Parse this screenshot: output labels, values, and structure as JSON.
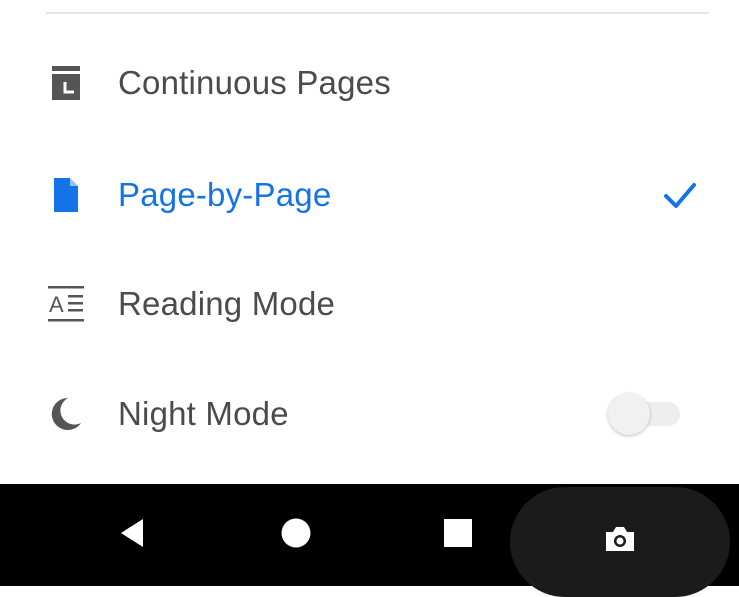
{
  "menu": {
    "items": [
      {
        "id": "continuous",
        "label": "Continuous Pages",
        "icon": "continuous-pages-icon",
        "selected": false
      },
      {
        "id": "page-by-page",
        "label": "Page-by-Page",
        "icon": "page-icon",
        "selected": true
      },
      {
        "id": "reading-mode",
        "label": "Reading Mode",
        "icon": "reading-mode-icon",
        "selected": false
      },
      {
        "id": "night-mode",
        "label": "Night Mode",
        "icon": "moon-icon",
        "selected": false,
        "toggle_on": false
      }
    ]
  },
  "colors": {
    "accent": "#1473e6",
    "text": "#4b4b4b",
    "icon": "#555555",
    "navbar": "#000000"
  },
  "navbar": {
    "buttons": [
      "back-icon",
      "home-icon",
      "recents-icon",
      "camera-icon"
    ]
  }
}
